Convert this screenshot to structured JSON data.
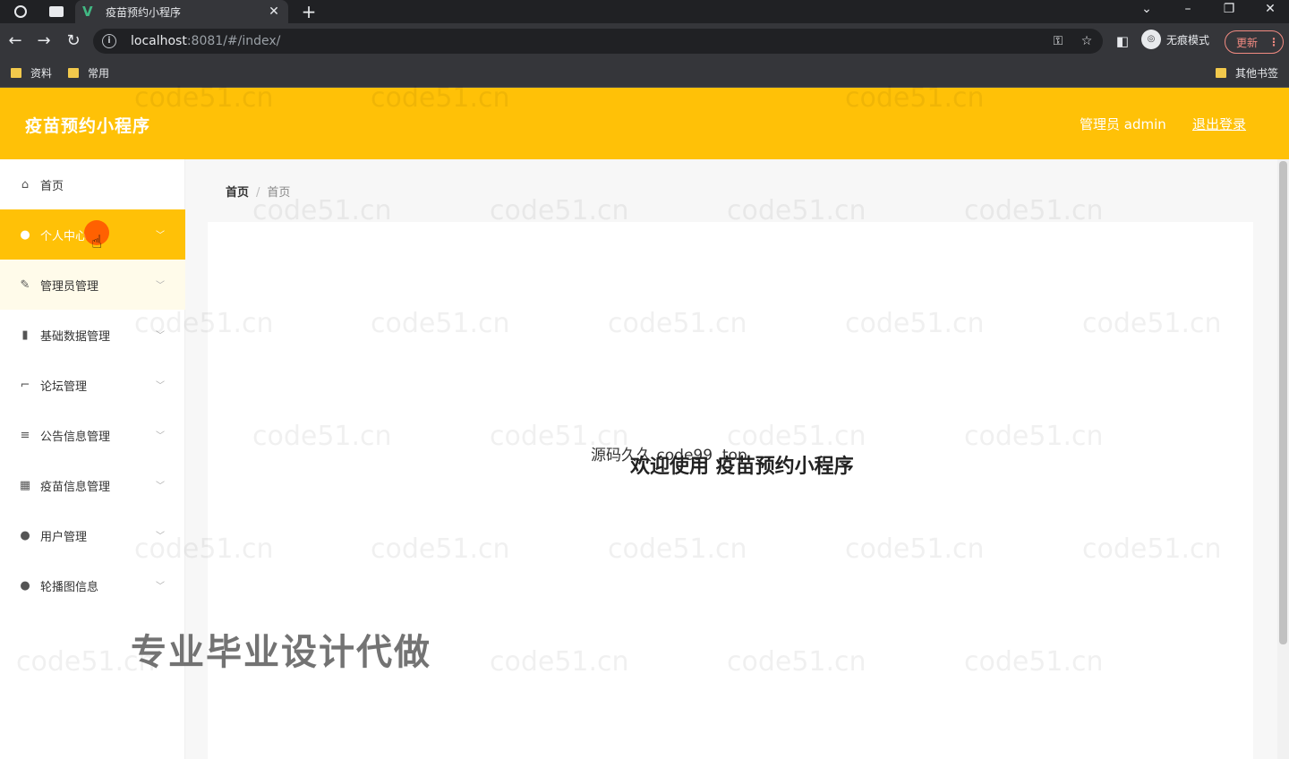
{
  "browser": {
    "tab_title": "疫苗预约小程序",
    "url_host": "localhost",
    "url_rest": ":8081/#/index/",
    "incognito_label": "无痕模式",
    "update_label": "更新",
    "bookmarks": [
      "资料",
      "常用"
    ],
    "other_bookmarks": "其他书签"
  },
  "header": {
    "brand": "疫苗预约小程序",
    "user_label": "管理员 admin",
    "logout": "退出登录"
  },
  "sidebar": {
    "items": [
      {
        "label": "首页",
        "icon": "home-icon"
      },
      {
        "label": "个人中心",
        "icon": "user-icon"
      },
      {
        "label": "管理员管理",
        "icon": "pen-icon"
      },
      {
        "label": "基础数据管理",
        "icon": "bar-chart-icon"
      },
      {
        "label": "论坛管理",
        "icon": "crop-icon"
      },
      {
        "label": "公告信息管理",
        "icon": "list-icon"
      },
      {
        "label": "疫苗信息管理",
        "icon": "grid-icon"
      },
      {
        "label": "用户管理",
        "icon": "person-icon"
      },
      {
        "label": "轮播图信息",
        "icon": "person-icon"
      }
    ]
  },
  "breadcrumb": {
    "root": "首页",
    "current": "首页"
  },
  "main": {
    "welcome": "欢迎使用 疫苗预约小程序",
    "overlay": "源码久久 code99 .top"
  },
  "watermark": "code51.cn",
  "promo": "专业毕业设计代做"
}
